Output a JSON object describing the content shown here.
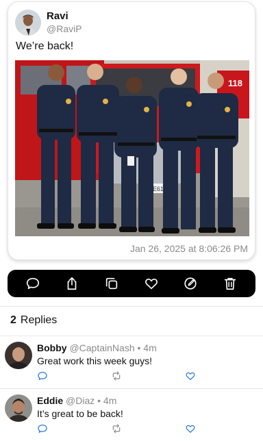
{
  "post": {
    "author_name": "Ravi",
    "author_handle": "@RaviP",
    "text": "We’re back!",
    "timestamp": "Jan 26, 2025 at 8:06:26 PM",
    "photo": {
      "truck_number": "118",
      "license_plate": "3E6145"
    }
  },
  "actions": [
    {
      "icon": "comment-icon"
    },
    {
      "icon": "share-icon"
    },
    {
      "icon": "copy-icon"
    },
    {
      "icon": "heart-icon"
    },
    {
      "icon": "edit-icon"
    },
    {
      "icon": "trash-icon"
    }
  ],
  "replies_header": {
    "count": "2",
    "label": "Replies"
  },
  "replies": [
    {
      "name": "Bobby",
      "handle": "@CaptainNash",
      "time": "4m",
      "text": "Great work this week guys!"
    },
    {
      "name": "Eddie",
      "handle": "@Diaz",
      "time": "4m",
      "text": "It’s great to be back!"
    }
  ],
  "colors": {
    "action_bar_bg": "#000000",
    "icon_blue": "#1a73e8",
    "muted_text": "#8a8a8a"
  }
}
